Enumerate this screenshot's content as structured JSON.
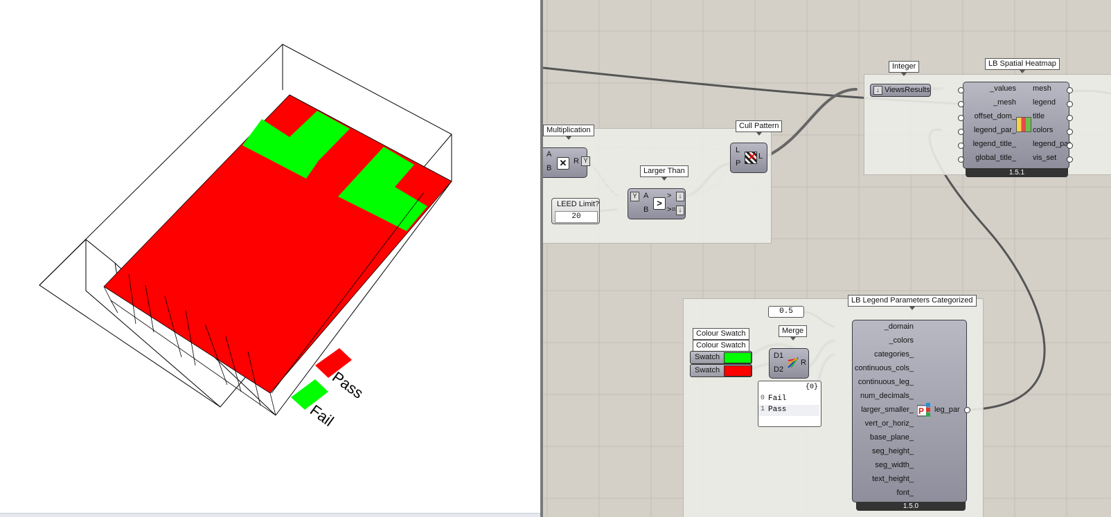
{
  "viewport": {
    "legend": {
      "pass_label": "Pass",
      "fail_label": "Fail"
    },
    "colors": {
      "pass": "#00ff00",
      "fail": "#ff0000",
      "background": "#ffffff"
    }
  },
  "canvas": {
    "background": "#d4d0c8",
    "multiplication": {
      "title": "Multiplication",
      "in_a": "A",
      "in_b": "B",
      "out_r": "R",
      "icon": "multiply-icon"
    },
    "leed": {
      "title": "LEED Limit?",
      "value": "20"
    },
    "larger": {
      "title": "Larger Than",
      "in_a": "A",
      "in_b": "B",
      "out_gt": ">",
      "out_ge": ">=",
      "icon": "greater-than-icon"
    },
    "cull": {
      "title": "Cull Pattern",
      "in_l": "L",
      "in_p": "P",
      "out_l": "L",
      "icon": "cull-pattern-icon"
    },
    "integer": {
      "title": "Integer",
      "label": "ViewsResults"
    },
    "heatmap": {
      "title": "LB Spatial Heatmap",
      "inputs": [
        "_values",
        "_mesh",
        "offset_dom_",
        "legend_par_",
        "legend_title_",
        "global_title_"
      ],
      "outputs": [
        "mesh",
        "legend",
        "title",
        "colors",
        "legend_par",
        "vis_set"
      ],
      "version": "1.5.1",
      "icon": "heatmap-icon"
    },
    "domain_panel": {
      "value": "0.5"
    },
    "swatches": {
      "title1": "Colour Swatch",
      "title2": "Colour Swatch",
      "label1": "Swatch",
      "label2": "Swatch",
      "color1": "#00ff00",
      "color2": "#ff0000"
    },
    "merge": {
      "title": "Merge",
      "in_d1": "D1",
      "in_d2": "D2",
      "out_r": "R",
      "icon": "merge-icon"
    },
    "list_panel": {
      "header": "{0}",
      "rows": [
        {
          "index": "0",
          "text": "Fail"
        },
        {
          "index": "1",
          "text": "Pass"
        }
      ]
    },
    "legend_params": {
      "title": "LB Legend Parameters Categorized",
      "inputs": [
        "_domain",
        "_colors",
        "categories_",
        "continuous_cols_",
        "continuous_leg_",
        "num_decimals_",
        "larger_smaller_",
        "vert_or_horiz_",
        "base_plane_",
        "seg_height_",
        "seg_width_",
        "text_height_",
        "font_"
      ],
      "output": "leg_par",
      "version": "1.5.0",
      "icon": "legend-parameters-icon"
    }
  }
}
